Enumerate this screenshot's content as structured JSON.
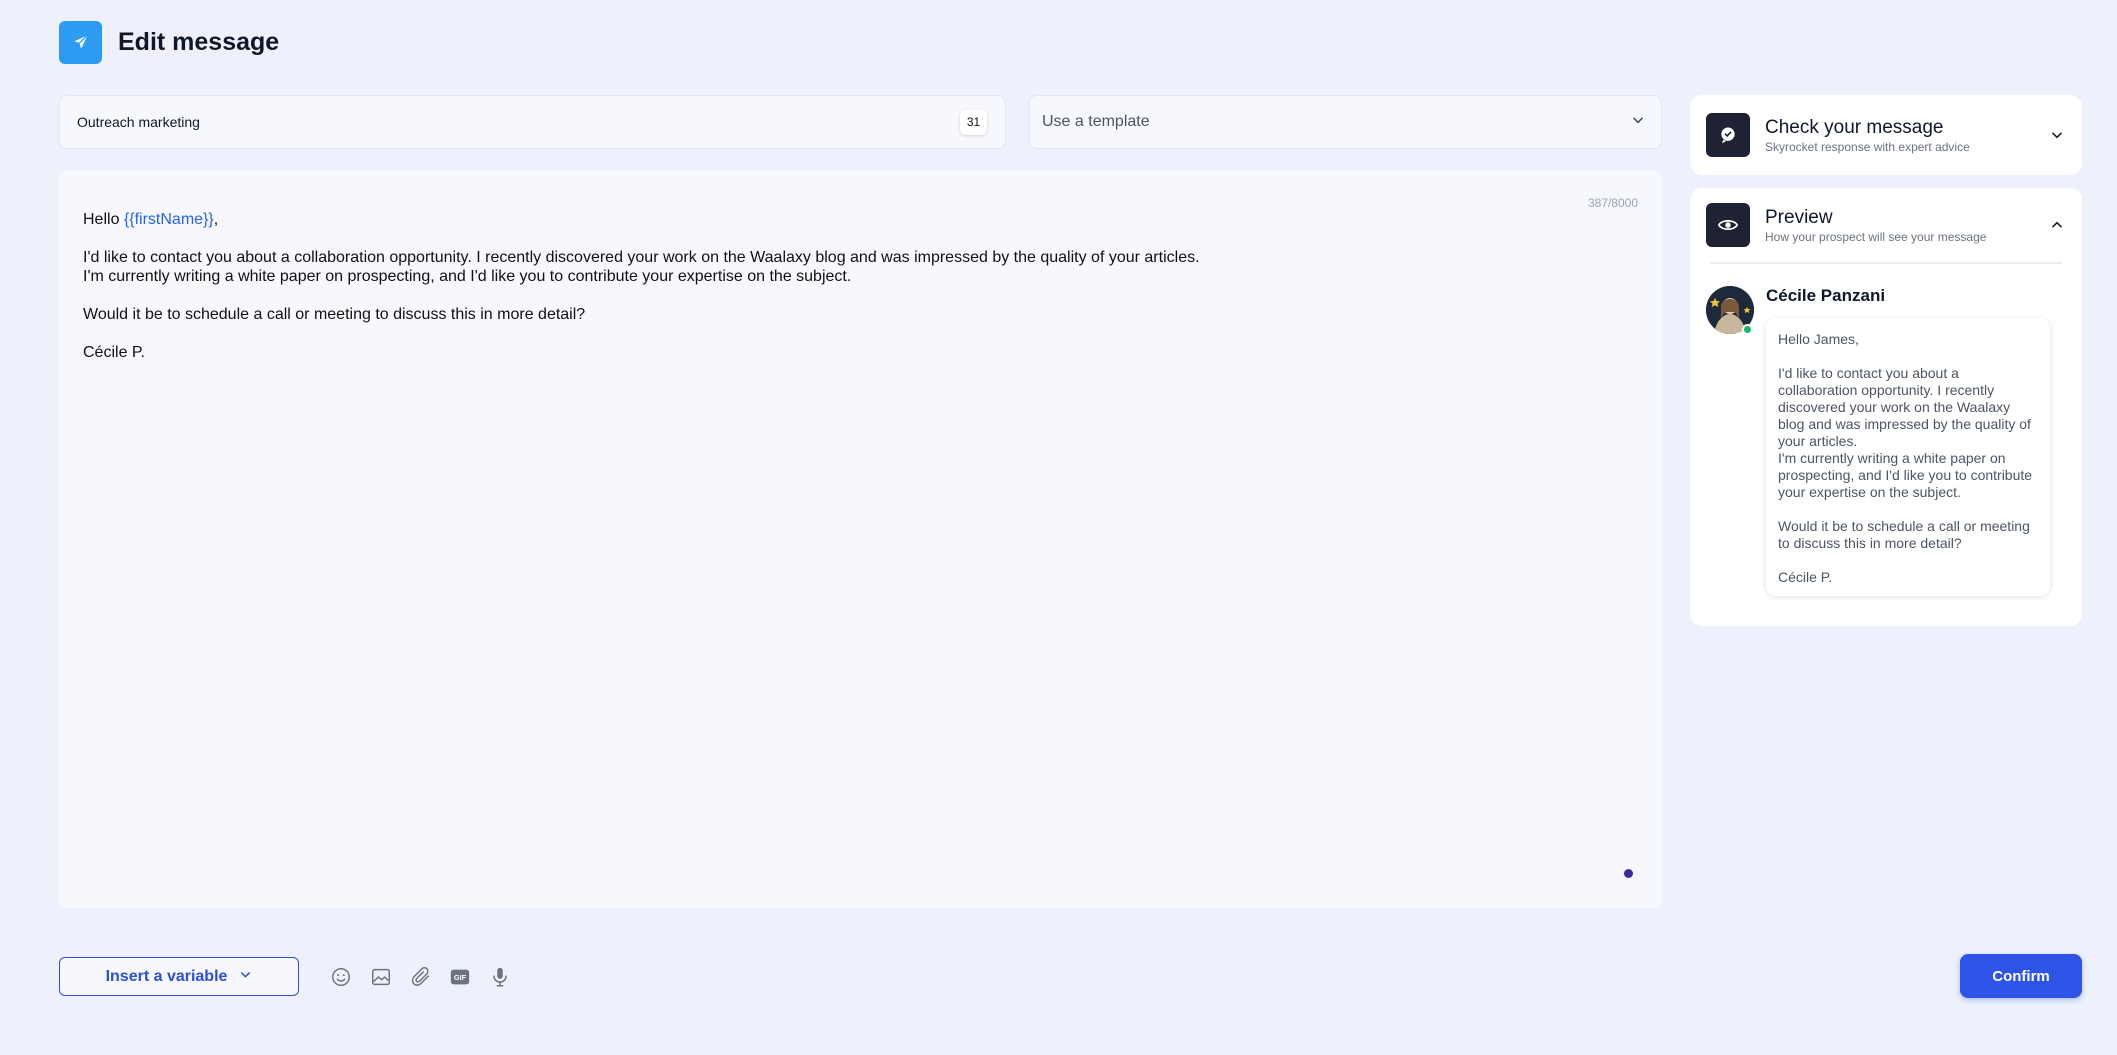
{
  "header": {
    "title": "Edit message",
    "icon": "paper-plane-icon",
    "accent_color": "#2b9cf2"
  },
  "campaign_name": {
    "value": "Outreach marketing",
    "char_count": "31"
  },
  "template_select": {
    "placeholder": "Use a template",
    "icon": "chevron-down-icon"
  },
  "editor": {
    "counter": "387/8000",
    "greeting_prefix": "Hello ",
    "variable": "{{firstName}}",
    "greeting_suffix": ",",
    "line1": "I'd like to contact you about a collaboration opportunity. I recently discovered your work on the Waalaxy blog and was impressed by the quality of your articles.",
    "line2": "I'm currently writing a white paper on prospecting, and I'd like you to contribute your expertise on the subject.",
    "question": "Would it be to schedule a call or meeting to discuss this in more detail?",
    "signature": "Cécile P."
  },
  "check_card": {
    "title": "Check your message",
    "subtitle": "Skyrocket response with expert advice",
    "icon": "chat-bubble-icon",
    "toggle_icon": "chevron-down-icon"
  },
  "preview_card": {
    "title": "Preview",
    "subtitle": "How your prospect will see your message",
    "icon": "eye-icon",
    "toggle_icon": "chevron-up-icon",
    "sender_name": "Cécile Panzani",
    "message": {
      "greeting": "Hello James,",
      "line1": "I'd like to contact you about a collaboration opportunity. I recently discovered your work on the Waalaxy blog and was impressed by the quality of your articles.",
      "line2": "I'm currently writing a white paper on prospecting, and I'd like you to contribute your expertise on the subject.",
      "question": "Would it be to schedule a call or meeting to discuss this in more detail?",
      "signature": "Cécile P."
    }
  },
  "toolbar": {
    "insert_variable_label": "Insert a variable",
    "tools": [
      "emoji-icon",
      "image-icon",
      "attachment-icon",
      "gif-icon",
      "microphone-icon"
    ],
    "gif_label": "GIF",
    "confirm_label": "Confirm",
    "primary_color": "#2d54e6"
  }
}
